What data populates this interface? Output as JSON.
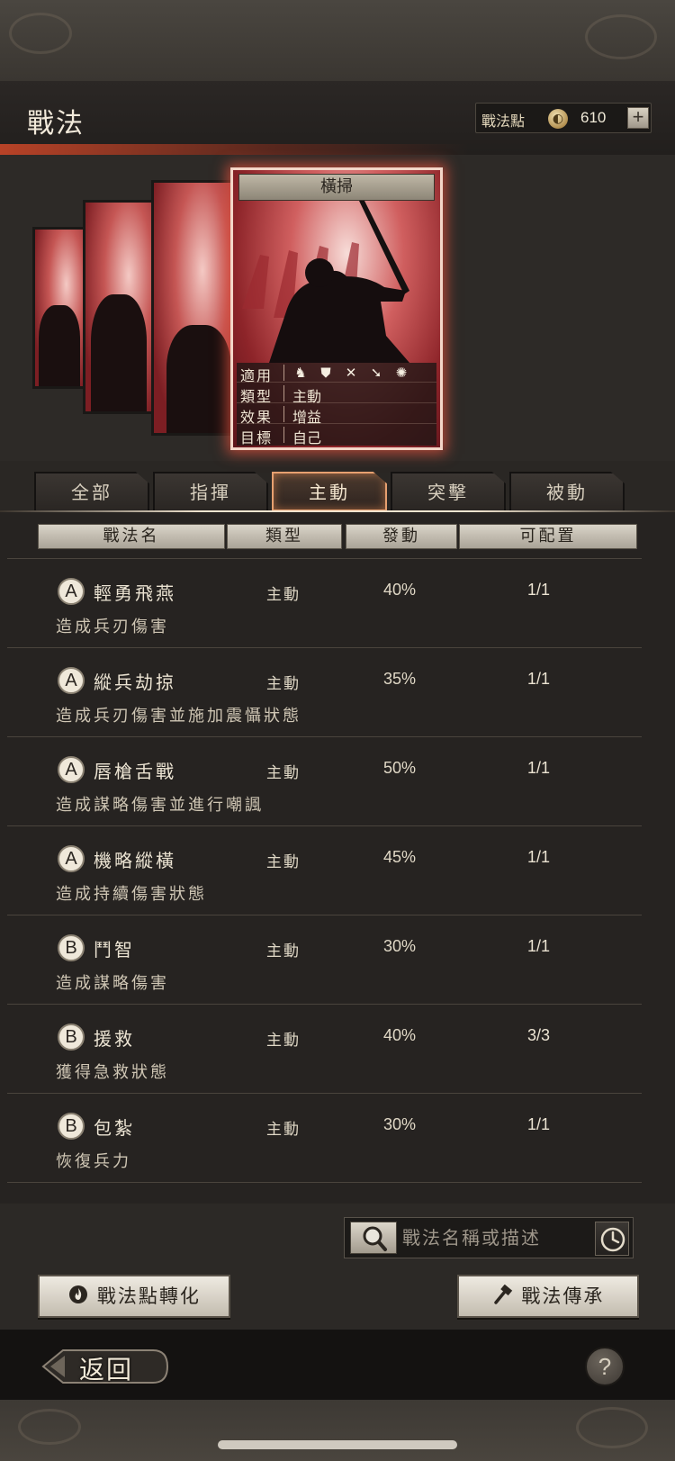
{
  "header": {
    "title": "戰法",
    "points_label": "戰法點",
    "points_value": "610",
    "points_plus": "+"
  },
  "featured_card": {
    "name": "橫掃",
    "info": [
      {
        "label": "適用",
        "value": ""
      },
      {
        "label": "類型",
        "value": "主動"
      },
      {
        "label": "效果",
        "value": "增益"
      },
      {
        "label": "目標",
        "value": "自己"
      }
    ],
    "apply_icons": [
      "cavalry-icon",
      "shield-icon",
      "bow-icon",
      "spear-icon",
      "wheel-icon"
    ]
  },
  "tabs": [
    {
      "label": "全部",
      "active": false
    },
    {
      "label": "指揮",
      "active": false
    },
    {
      "label": "主動",
      "active": true
    },
    {
      "label": "突擊",
      "active": false
    },
    {
      "label": "被動",
      "active": false
    }
  ],
  "columns": [
    "戰法名",
    "類型",
    "發動",
    "可配置"
  ],
  "skills": [
    {
      "grade": "A",
      "name": "輕勇飛燕",
      "type": "主動",
      "rate": "40%",
      "slots": "1/1",
      "desc": "造成兵刃傷害"
    },
    {
      "grade": "A",
      "name": "縱兵劫掠",
      "type": "主動",
      "rate": "35%",
      "slots": "1/1",
      "desc": "造成兵刃傷害並施加震懾狀態"
    },
    {
      "grade": "A",
      "name": "唇槍舌戰",
      "type": "主動",
      "rate": "50%",
      "slots": "1/1",
      "desc": "造成謀略傷害並進行嘲諷"
    },
    {
      "grade": "A",
      "name": "機略縱橫",
      "type": "主動",
      "rate": "45%",
      "slots": "1/1",
      "desc": "造成持續傷害狀態"
    },
    {
      "grade": "B",
      "name": "鬥智",
      "type": "主動",
      "rate": "30%",
      "slots": "1/1",
      "desc": "造成謀略傷害"
    },
    {
      "grade": "B",
      "name": "援救",
      "type": "主動",
      "rate": "40%",
      "slots": "3/3",
      "desc": "獲得急救狀態"
    },
    {
      "grade": "B",
      "name": "包紮",
      "type": "主動",
      "rate": "30%",
      "slots": "1/1",
      "desc": "恢復兵力"
    }
  ],
  "search": {
    "placeholder": "戰法名稱或描述"
  },
  "buttons": {
    "convert": "戰法點轉化",
    "inherit": "戰法傳承",
    "back": "返回",
    "help": "?"
  }
}
